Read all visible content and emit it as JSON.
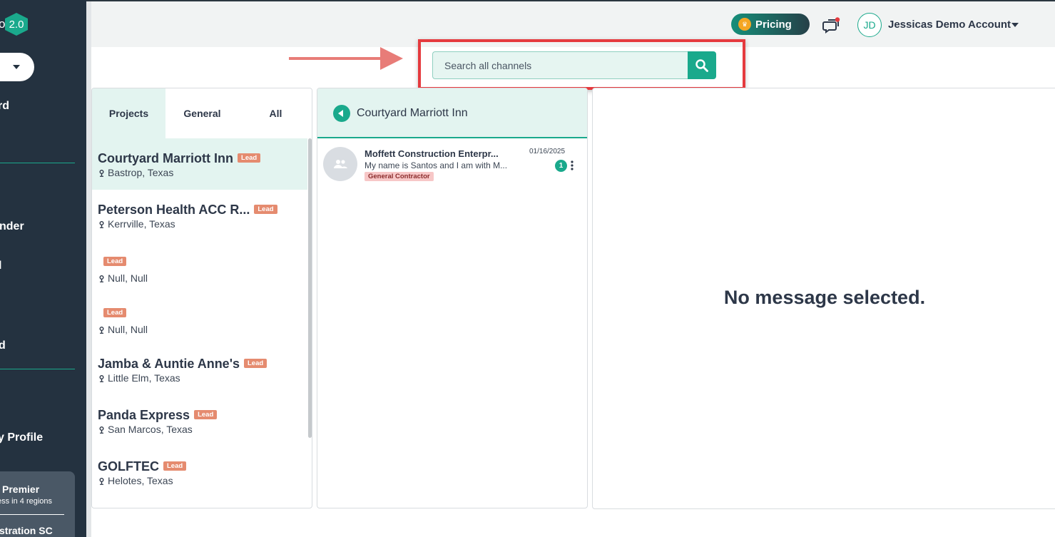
{
  "app": {
    "logo_prefix": "o",
    "logo_version": "2.0"
  },
  "sidebar": {
    "items": [
      {
        "label": "rd"
      },
      {
        "label": "nder"
      },
      {
        "label": "l"
      },
      {
        "label": "d"
      },
      {
        "label": "y Profile"
      }
    ],
    "plan": {
      "title": "Premier",
      "subtitle": "ess in 4 regions",
      "bottom": "stration SC"
    }
  },
  "header": {
    "pricing_label": "Pricing",
    "avatar_initials": "JD",
    "account_name": "Jessicas Demo Account"
  },
  "search": {
    "placeholder": "Search all channels",
    "value": ""
  },
  "tabs": [
    {
      "label": "Projects",
      "active": true
    },
    {
      "label": "General",
      "active": false
    },
    {
      "label": "All",
      "active": false
    }
  ],
  "projects": [
    {
      "name": "Courtyard Marriott Inn",
      "badge": "Lead",
      "location": "Bastrop, Texas",
      "selected": true
    },
    {
      "name": "Peterson Health ACC R...",
      "badge": "Lead",
      "location": "Kerrville, Texas"
    },
    {
      "name": "",
      "badge": "Lead",
      "location": "Null, Null"
    },
    {
      "name": "",
      "badge": "Lead",
      "location": "Null, Null"
    },
    {
      "name": "Jamba & Auntie Anne's",
      "badge": "Lead",
      "location": "Little Elm, Texas"
    },
    {
      "name": "Panda Express",
      "badge": "Lead",
      "location": "San Marcos, Texas"
    },
    {
      "name": "GOLFTEC",
      "badge": "Lead",
      "location": "Helotes, Texas"
    }
  ],
  "channel": {
    "title": "Courtyard Marriott Inn",
    "messages": [
      {
        "sender": "Moffett Construction Enterpr...",
        "preview": "My name is Santos and I am with M...",
        "role": "General Contractor",
        "date": "01/16/2025",
        "unread": "1"
      }
    ]
  },
  "message_panel": {
    "empty_text": "No message selected."
  },
  "colors": {
    "accent": "#1aa98c",
    "sidebar_bg": "#243240",
    "lead_badge": "#e58b6f",
    "highlight": "#e53a3e"
  }
}
